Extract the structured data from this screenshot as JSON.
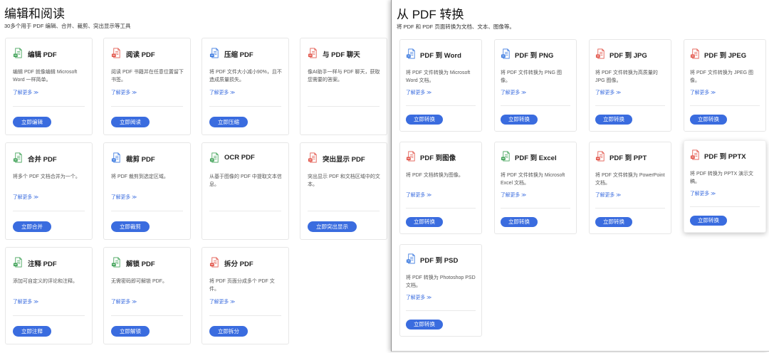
{
  "colors": {
    "button": "#3a6cdf",
    "link": "#3a6cdf"
  },
  "left": {
    "title": "编辑和阅读",
    "subtitle": "30多个用于 PDF 编辑、合并、裁剪、突出显示等工具",
    "cards": [
      {
        "icon": "edit-pdf-icon",
        "color": "#43a35a",
        "title": "编辑 PDF",
        "desc": "编辑 PDF 就像编辑 Microsoft Word 一样简单。",
        "link": "了解更多 ≫",
        "button": "立即编辑"
      },
      {
        "icon": "read-pdf-icon",
        "color": "#e2574c",
        "title": "阅读 PDF",
        "desc": "阅读 PDF 书籍并在任意位置留下书签。",
        "link": "了解更多 ≫",
        "button": "立即阅读"
      },
      {
        "icon": "compress-pdf-icon",
        "color": "#3d7be0",
        "title": "压缩 PDF",
        "desc": "将 PDF 文件大小减小90%，且不造成质量损失。",
        "link": "了解更多 ≫",
        "button": "立即压缩"
      },
      {
        "icon": "chat-pdf-icon",
        "color": "#e2574c",
        "title": "与 PDF 聊天",
        "desc": "像AI助手一样与 PDF 聊天，获取您需要的答案。"
      },
      {
        "icon": "merge-pdf-icon",
        "color": "#43a35a",
        "title": "合并 PDF",
        "desc": "将多个 PDF 文档合并为一个。",
        "link": "了解更多 ≫",
        "button": "立即合并"
      },
      {
        "icon": "crop-pdf-icon",
        "color": "#3d7be0",
        "title": "裁剪 PDF",
        "desc": "将 PDF 裁剪到选定区域。",
        "link": "了解更多 ≫",
        "button": "立即裁剪"
      },
      {
        "icon": "ocr-pdf-icon",
        "color": "#43a35a",
        "title": "OCR PDF",
        "desc": "从基于图像的 PDF 中提取文本信息。"
      },
      {
        "icon": "highlight-pdf-icon",
        "color": "#e2574c",
        "title": "突出显示 PDF",
        "desc": "突出显示 PDF 和文档区域中的文本。",
        "button": "立即突出显示"
      },
      {
        "icon": "annotate-pdf-icon",
        "color": "#43a35a",
        "title": "注释 PDF",
        "desc": "添加可自定义的评论和注释。",
        "link": "了解更多 ≫",
        "button": "立即注释"
      },
      {
        "icon": "unlock-pdf-icon",
        "color": "#43a35a",
        "title": "解锁 PDF",
        "desc": "无需密码即可解锁 PDF。",
        "link": "了解更多 ≫",
        "button": "立即解锁"
      },
      {
        "icon": "split-pdf-icon",
        "color": "#e2574c",
        "title": "拆分 PDF",
        "desc": "将 PDF 页面分成多个 PDF 文件。",
        "link": "了解更多 ≫",
        "button": "立即拆分"
      }
    ]
  },
  "right": {
    "title": "从 PDF 转换",
    "subtitle": "将 PDF 和 PDF 页面转换为文档、文本、图像等。",
    "cards": [
      {
        "icon": "pdf-to-word-icon",
        "color": "#3d7be0",
        "title": "PDF 到 Word",
        "desc": "将 PDF 文件转换为 Microsoft Word 文档。",
        "link": "了解更多 ≫",
        "button": "立即转换"
      },
      {
        "icon": "pdf-to-png-icon",
        "color": "#3d7be0",
        "title": "PDF 到 PNG",
        "desc": "将 PDF 文件转换为 PNG 图像。",
        "link": "了解更多 ≫",
        "button": "立即转换"
      },
      {
        "icon": "pdf-to-jpg-icon",
        "color": "#e2574c",
        "title": "PDF 到 JPG",
        "desc": "将 PDF 文件转换为高质量的 JPG 图像。",
        "link": "了解更多 ≫",
        "button": "立即转换"
      },
      {
        "icon": "pdf-to-jpeg-icon",
        "color": "#e2574c",
        "title": "PDF 到 JPEG",
        "desc": "将 PDF 文件转换为 JPEG 图像。",
        "link": "了解更多 ≫",
        "button": "立即转换"
      },
      {
        "icon": "pdf-to-image-icon",
        "color": "#e2574c",
        "title": "PDF 到图像",
        "desc": "将 PDF 文档转换为图像。",
        "link": "了解更多 ≫",
        "button": "立即转换"
      },
      {
        "icon": "pdf-to-excel-icon",
        "color": "#43a35a",
        "title": "PDF 到 Excel",
        "desc": "将 PDF 文件转换为 Microsoft Excel 文档。",
        "link": "了解更多 ≫",
        "button": "立即转换"
      },
      {
        "icon": "pdf-to-ppt-icon",
        "color": "#e2574c",
        "title": "PDF 到 PPT",
        "desc": "将 PDF 文件转换为 PowerPoint 文档。",
        "link": "了解更多 ≫",
        "button": "立即转换"
      },
      {
        "icon": "pdf-to-pptx-icon",
        "color": "#e2574c",
        "title": "PDF 到 PPTX",
        "desc": "将 PDF 转换为 PPTX 演示文稿。",
        "link": "了解更多 ≫",
        "button": "立即转换",
        "hovered": true
      },
      {
        "icon": "pdf-to-psd-icon",
        "color": "#3d7be0",
        "title": "PDF 到 PSD",
        "desc": "将 PDF 转换为 Photoshop PSD 文档。",
        "link": "了解更多 ≫",
        "button": "立即转换"
      }
    ]
  }
}
